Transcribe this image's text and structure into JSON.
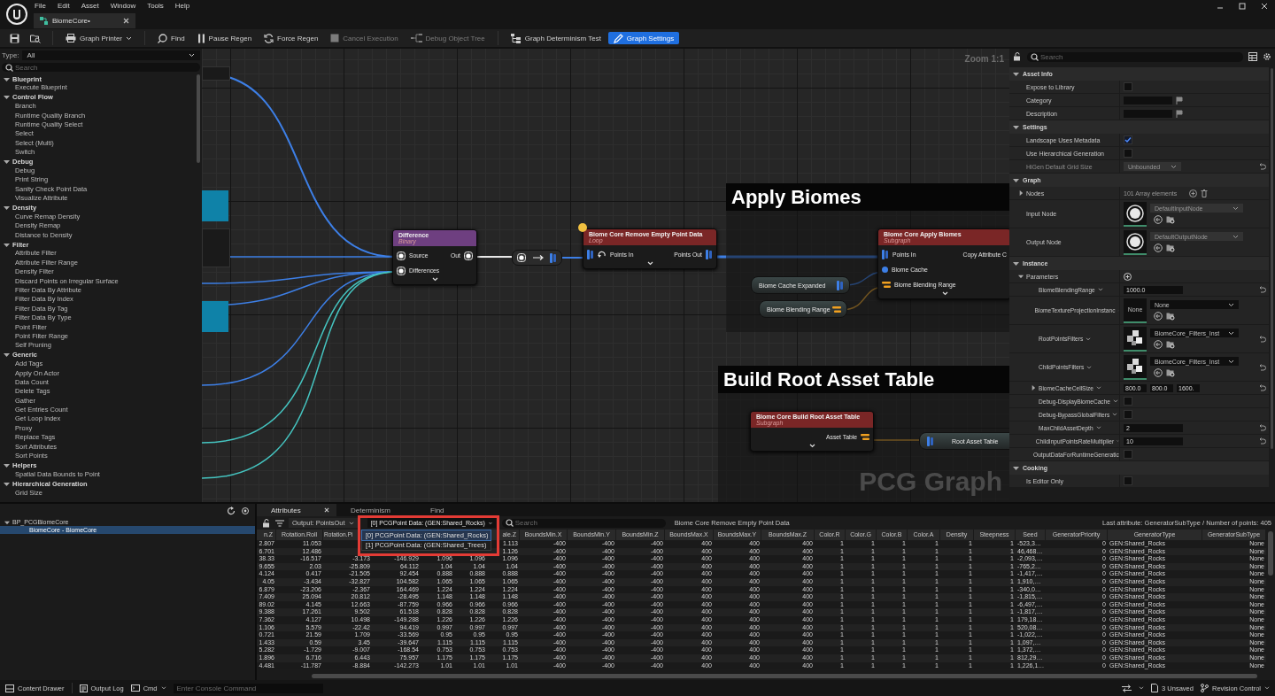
{
  "menu": [
    "File",
    "Edit",
    "Asset",
    "Window",
    "Tools",
    "Help"
  ],
  "document_tab": {
    "label": "BiomeCore•",
    "selected": true
  },
  "toolbar": [
    {
      "kind": "icon"
    },
    {
      "kind": "icon"
    },
    {
      "kind": "menu",
      "label": "Graph Printer",
      "disabled": false,
      "selected": false
    },
    {
      "kind": "button",
      "label": "Find",
      "disabled": false,
      "selected": false
    },
    {
      "kind": "button",
      "label": "Pause Regen",
      "disabled": false,
      "selected": false
    },
    {
      "kind": "button",
      "label": "Force Regen",
      "disabled": false,
      "selected": false
    },
    {
      "kind": "button",
      "label": "Cancel Execution",
      "disabled": true,
      "selected": false
    },
    {
      "kind": "button",
      "label": "Debug Object Tree",
      "disabled": true,
      "selected": false
    },
    {
      "kind": "button",
      "label": "Graph Determinism Test",
      "disabled": false,
      "selected": false
    },
    {
      "kind": "button",
      "label": "Graph Settings",
      "disabled": false,
      "selected": true
    }
  ],
  "palette": {
    "type_label": "Type:",
    "type_value": "All",
    "search_placeholder": "Search",
    "categories": [
      {
        "name": "Blueprint",
        "expanded": true,
        "items": [
          "Execute Blueprint"
        ]
      },
      {
        "name": "Control Flow",
        "expanded": true,
        "items": [
          "Branch",
          "Runtime Quality Branch",
          "Runtime Quality Select",
          "Select",
          "Select (Multi)",
          "Switch"
        ]
      },
      {
        "name": "Debug",
        "expanded": true,
        "items": [
          "Debug",
          "Print String",
          "Sanity Check Point Data",
          "Visualize Attribute"
        ]
      },
      {
        "name": "Density",
        "expanded": true,
        "items": [
          "Curve Remap Density",
          "Density Remap",
          "Distance to Density"
        ]
      },
      {
        "name": "Filter",
        "expanded": true,
        "items": [
          "Attribute Filter",
          "Attribute Filter Range",
          "Density Filter",
          "Discard Points on Irregular Surface",
          "Filter Data By Attribute",
          "Filter Data By Index",
          "Filter Data By Tag",
          "Filter Data By Type",
          "Point Filter",
          "Point Filter Range",
          "Self Pruning"
        ]
      },
      {
        "name": "Generic",
        "expanded": true,
        "items": [
          "Add Tags",
          "Apply On Actor",
          "Data Count",
          "Delete Tags",
          "Gather",
          "Get Entries Count",
          "Get Loop Index",
          "Proxy",
          "Replace Tags",
          "Sort Attributes",
          "Sort Points"
        ]
      },
      {
        "name": "Helpers",
        "expanded": true,
        "items": [
          "Spatial Data Bounds to Point"
        ]
      },
      {
        "name": "Hierarchical Generation",
        "expanded": true,
        "items": [
          "Grid Size"
        ]
      }
    ]
  },
  "graph": {
    "zoom": "Zoom 1:1",
    "watermark": "PCG Graph",
    "comments": [
      {
        "title": "Apply Biomes"
      },
      {
        "title": "Build Root Asset Table"
      }
    ],
    "nodes": [
      {
        "kind": "node",
        "title": "Difference",
        "subtitle": "Binary",
        "color": "#6e3f80",
        "indicator": false,
        "inputs": [
          {
            "label": "Source",
            "kind": "data"
          },
          {
            "label": "Differences",
            "kind": "data"
          }
        ],
        "outputs": [
          {
            "label": "Out",
            "kind": "data"
          }
        ]
      },
      {
        "kind": "reroute"
      },
      {
        "kind": "node",
        "title": "Biome Core Remove Empty Point Data",
        "subtitle": "Loop",
        "color": "#7a2626",
        "indicator": true,
        "inputs": [
          {
            "label": "Points In",
            "kind": "loop_points"
          }
        ],
        "outputs": [
          {
            "label": "Points Out",
            "kind": "points"
          }
        ]
      },
      {
        "kind": "getter",
        "label": "Biome Cache Expanded",
        "outputs": [
          {
            "kind": "points"
          }
        ]
      },
      {
        "kind": "getter",
        "label": "Biome Blending Range",
        "outputs": [
          {
            "kind": "param"
          }
        ]
      },
      {
        "kind": "node",
        "title": "Biome Core Apply Biomes",
        "subtitle": "Subgraph",
        "color": "#7a2626",
        "indicator": false,
        "inputs": [
          {
            "label": "Points In",
            "kind": "points"
          },
          {
            "label": "Biome Cache",
            "kind": "cache"
          },
          {
            "label": "Biome Blending Range",
            "kind": "param"
          }
        ],
        "outputs": [
          {
            "label": "Copy Attribute C"
          }
        ]
      },
      {
        "kind": "node",
        "title": "Biome Core Build Root Asset Table",
        "subtitle": "Subgraph",
        "color": "#7a2626",
        "indicator": false,
        "outputs": [
          {
            "label": "Asset Table",
            "kind": "param"
          }
        ]
      },
      {
        "kind": "getter",
        "label": "Root Asset Table",
        "inputs": [
          {
            "kind": "points"
          }
        ]
      }
    ]
  },
  "details": {
    "search_placeholder": "Search",
    "sections": [
      {
        "title": "Asset Info",
        "expanded": true,
        "rows": [
          {
            "label": "Expose to Library",
            "kind": "checkbox",
            "checked": false
          },
          {
            "label": "Category",
            "kind": "tag"
          },
          {
            "label": "Description",
            "kind": "tag"
          }
        ]
      },
      {
        "title": "Settings",
        "expanded": true,
        "rows": [
          {
            "label": "Landscape Uses Metadata",
            "kind": "checkbox",
            "checked": true
          },
          {
            "label": "Use Hierarchical Generation",
            "kind": "checkbox",
            "checked": false
          },
          {
            "label": "HiGen Default Grid Size",
            "kind": "dropdown",
            "value": "Unbounded",
            "disabled": true,
            "resettable": true
          }
        ]
      },
      {
        "title": "Graph",
        "expanded": true,
        "rows": [
          {
            "label": "Nodes",
            "kind": "array",
            "value": "101 Array elements",
            "expanded": false
          },
          {
            "label": "Input Node",
            "kind": "asset",
            "thumb": {
              "kind": "sphere"
            },
            "value": "DefaultInputNode",
            "disabled": true
          },
          {
            "label": "Output Node",
            "kind": "asset",
            "thumb": {
              "kind": "sphere"
            },
            "value": "DefaultOutputNode",
            "disabled": true
          }
        ]
      },
      {
        "title": "Instance",
        "expanded": true,
        "rows": [
          {
            "label": "Parameters",
            "kind": "group",
            "expanded": true,
            "children": [
              {
                "label": "BiomeBlendingRange",
                "kind": "number",
                "value": "1000.0",
                "resettable": true
              },
              {
                "label": "BiomeTextureProjectionInstanc",
                "kind": "asset",
                "thumb": {
                  "kind": "empty",
                  "label": "None"
                },
                "value": "None",
                "disabled": false
              },
              {
                "label": "RootPointsFilters",
                "kind": "asset",
                "thumb": {
                  "kind": "cubes"
                },
                "value": "BiomeCore_Filters_Inst",
                "disabled": false,
                "resettable": true
              },
              {
                "label": "ChildPointsFilters",
                "kind": "asset",
                "thumb": {
                  "kind": "cubes"
                },
                "value": "BiomeCore_Filters_Inst",
                "disabled": false,
                "resettable": true
              },
              {
                "label": "BiomeCacheCellSize",
                "kind": "vector",
                "values": [
                  "800.0",
                  "800.0",
                  "1600."
                ],
                "expanded": false,
                "resettable": true
              },
              {
                "label": "Debug-DisplayBiomeCache",
                "kind": "checkbox",
                "checked": false
              },
              {
                "label": "Debug-BypassGlobalFilters",
                "kind": "checkbox",
                "checked": false
              },
              {
                "label": "MaxChildAssetDepth",
                "kind": "number",
                "value": "2",
                "resettable": true
              },
              {
                "label": "ChildInputPointsRateMultiplier",
                "kind": "number",
                "value": "10",
                "resettable": true
              },
              {
                "label": "OutputDataForRuntimeGeneratic",
                "kind": "checkbox",
                "checked": false
              }
            ]
          }
        ]
      },
      {
        "title": "Cooking",
        "expanded": true,
        "rows": [
          {
            "label": "Is Editor Only",
            "kind": "checkbox",
            "checked": false
          }
        ]
      }
    ]
  },
  "outliner": {
    "items": [
      {
        "label": "BP_PCGBiomeCore",
        "expanded": true,
        "selected": false,
        "children": [
          {
            "label": "BiomeCore - BiomeCore",
            "selected": true
          }
        ]
      }
    ]
  },
  "attributes": {
    "tabs": [
      {
        "label": "Attributes",
        "selected": true,
        "closable": true
      },
      {
        "label": "Determinism",
        "selected": false,
        "closable": false
      },
      {
        "label": "Find",
        "selected": false,
        "closable": false
      }
    ],
    "output_dropdown": "Output: PointsOut",
    "data_dropdown": {
      "value": "[0] PCGPoint Data: (GEN:Shared_Rocks)",
      "open": true,
      "options": [
        {
          "label": "[0] PCGPoint Data: (GEN:Shared_Rocks)",
          "selected": true
        },
        {
          "label": "[1] PCGPoint Data: (GEN:Shared_Trees)",
          "selected": false
        }
      ]
    },
    "search_placeholder": "Search",
    "node_name": "Biome Core Remove Empty Point Data",
    "summary": "Last attribute: GeneratorSubType / Number of points: 405",
    "columns": [
      "n.Z",
      "Rotation.Roll",
      "Rotation.Pi",
      null,
      null,
      null,
      "ale.Z",
      "BoundsMin.X",
      "BoundsMin.Y",
      "BoundsMin.Z",
      "BoundsMax.X",
      "BoundsMax.Y",
      "BoundsMax.Z",
      "Color.R",
      "Color.G",
      "Color.B",
      "Color.A",
      "Density",
      "Steepness",
      "Seed",
      "GeneratorPriority",
      "GeneratorType",
      "GeneratorSubType"
    ],
    "rows": [
      [
        "2.807",
        "11.053",
        null,
        null,
        null,
        null,
        "1.113",
        "-400",
        "-400",
        "-400",
        "400",
        "400",
        "400",
        "1",
        "1",
        "1",
        "1",
        "1",
        "1",
        "-523,3…",
        "0",
        "GEN:Shared_Rocks",
        "None"
      ],
      [
        "6.701",
        "12.486",
        null,
        null,
        null,
        null,
        "1.126",
        "-400",
        "-400",
        "-400",
        "400",
        "400",
        "400",
        "1",
        "1",
        "1",
        "1",
        "1",
        "1",
        "46,468…",
        "0",
        "GEN:Shared_Rocks",
        "None"
      ],
      [
        "38.33",
        "-16.517",
        "-3.173",
        "-146.929",
        "1.096",
        "1.096",
        "1.096",
        "-400",
        "-400",
        "-400",
        "400",
        "400",
        "400",
        "1",
        "1",
        "1",
        "1",
        "1",
        "1",
        "-2,093,…",
        "0",
        "GEN:Shared_Rocks",
        "None"
      ],
      [
        "9.655",
        "2.03",
        "-25.809",
        "64.112",
        "1.04",
        "1.04",
        "1.04",
        "-400",
        "-400",
        "-400",
        "400",
        "400",
        "400",
        "1",
        "1",
        "1",
        "1",
        "1",
        "1",
        "-765,2…",
        "0",
        "GEN:Shared_Rocks",
        "None"
      ],
      [
        "4.124",
        "0.417",
        "-21.505",
        "92.454",
        "0.888",
        "0.888",
        "0.888",
        "-400",
        "-400",
        "-400",
        "400",
        "400",
        "400",
        "1",
        "1",
        "1",
        "1",
        "1",
        "1",
        "-1,417,…",
        "0",
        "GEN:Shared_Rocks",
        "None"
      ],
      [
        "4.05",
        "-3.434",
        "-32.827",
        "104.582",
        "1.065",
        "1.065",
        "1.065",
        "-400",
        "-400",
        "-400",
        "400",
        "400",
        "400",
        "1",
        "1",
        "1",
        "1",
        "1",
        "1",
        "1,910,…",
        "0",
        "GEN:Shared_Rocks",
        "None"
      ],
      [
        "6.879",
        "-23.206",
        "-2.367",
        "164.469",
        "1.224",
        "1.224",
        "1.224",
        "-400",
        "-400",
        "-400",
        "400",
        "400",
        "400",
        "1",
        "1",
        "1",
        "1",
        "1",
        "1",
        "-340,0…",
        "0",
        "GEN:Shared_Rocks",
        "None"
      ],
      [
        "7.409",
        "25.094",
        "20.812",
        "-28.495",
        "1.148",
        "1.148",
        "1.148",
        "-400",
        "-400",
        "-400",
        "400",
        "400",
        "400",
        "1",
        "1",
        "1",
        "1",
        "1",
        "1",
        "-1,815,…",
        "0",
        "GEN:Shared_Rocks",
        "None"
      ],
      [
        "89.02",
        "4.145",
        "12.663",
        "-87.759",
        "0.966",
        "0.966",
        "0.966",
        "-400",
        "-400",
        "-400",
        "400",
        "400",
        "400",
        "1",
        "1",
        "1",
        "1",
        "1",
        "1",
        "-6,497,…",
        "0",
        "GEN:Shared_Rocks",
        "None"
      ],
      [
        "9.388",
        "17.261",
        "9.502",
        "61.518",
        "0.828",
        "0.828",
        "0.828",
        "-400",
        "-400",
        "-400",
        "400",
        "400",
        "400",
        "1",
        "1",
        "1",
        "1",
        "1",
        "1",
        "-1,817,…",
        "0",
        "GEN:Shared_Rocks",
        "None"
      ],
      [
        "7.362",
        "4.127",
        "10.498",
        "-149.288",
        "1.226",
        "1.226",
        "1.226",
        "-400",
        "-400",
        "-400",
        "400",
        "400",
        "400",
        "1",
        "1",
        "1",
        "1",
        "1",
        "1",
        "179,18…",
        "0",
        "GEN:Shared_Rocks",
        "None"
      ],
      [
        "1.106",
        "5.579",
        "-22.42",
        "94.419",
        "0.997",
        "0.997",
        "0.997",
        "-400",
        "-400",
        "-400",
        "400",
        "400",
        "400",
        "1",
        "1",
        "1",
        "1",
        "1",
        "1",
        "520,08…",
        "0",
        "GEN:Shared_Rocks",
        "None"
      ],
      [
        "0.721",
        "21.59",
        "1.709",
        "-33.569",
        "0.95",
        "0.95",
        "0.95",
        "-400",
        "-400",
        "-400",
        "400",
        "400",
        "400",
        "1",
        "1",
        "1",
        "1",
        "1",
        "1",
        "-1,022,…",
        "0",
        "GEN:Shared_Rocks",
        "None"
      ],
      [
        "1.433",
        "0.59",
        "3.45",
        "-39.647",
        "1.115",
        "1.115",
        "1.115",
        "-400",
        "-400",
        "-400",
        "400",
        "400",
        "400",
        "1",
        "1",
        "1",
        "1",
        "1",
        "1",
        "1,097,…",
        "0",
        "GEN:Shared_Rocks",
        "None"
      ],
      [
        "5.282",
        "-1.729",
        "-9.007",
        "-168.54",
        "0.753",
        "0.753",
        "0.753",
        "-400",
        "-400",
        "-400",
        "400",
        "400",
        "400",
        "1",
        "1",
        "1",
        "1",
        "1",
        "1",
        "1,372,…",
        "0",
        "GEN:Shared_Rocks",
        "None"
      ],
      [
        "1.896",
        "6.716",
        "6.443",
        "75.957",
        "1.175",
        "1.175",
        "1.175",
        "-400",
        "-400",
        "-400",
        "400",
        "400",
        "400",
        "1",
        "1",
        "1",
        "1",
        "1",
        "1",
        "812,29…",
        "0",
        "GEN:Shared_Rocks",
        "None"
      ],
      [
        "4.481",
        "-11.787",
        "-8.884",
        "-142.273",
        "1.01",
        "1.01",
        "1.01",
        "-400",
        "-400",
        "-400",
        "400",
        "400",
        "400",
        "1",
        "1",
        "1",
        "1",
        "1",
        "1",
        "1,226,1…",
        "0",
        "GEN:Shared_Rocks",
        "None"
      ]
    ]
  },
  "status_bar": {
    "buttons": [
      "Content Drawer",
      "Output Log"
    ],
    "cmd": "Cmd",
    "console_placeholder": "Enter Console Command",
    "unsaved": "3 Unsaved",
    "revision": "Revision Control"
  }
}
